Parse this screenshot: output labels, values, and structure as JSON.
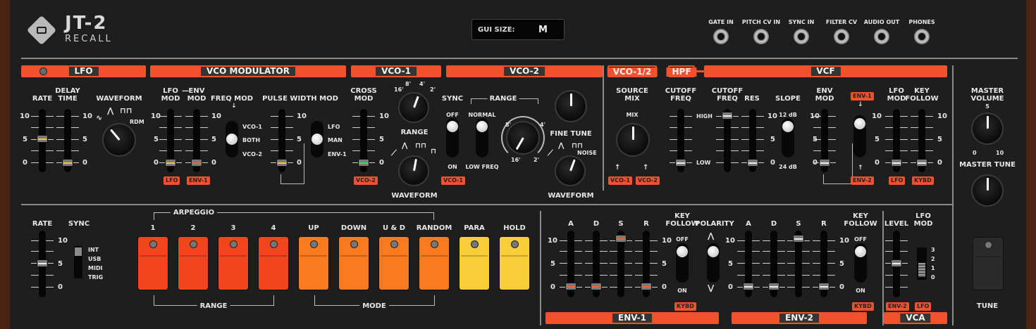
{
  "brand": {
    "title": "JT-2",
    "subtitle": "RECALL"
  },
  "gui_size": {
    "label": "GUI SIZE:",
    "value": "M"
  },
  "jacks": [
    "GATE IN",
    "PITCH CV IN",
    "SYNC IN",
    "FILTER CV",
    "AUDIO OUT",
    "PHONES"
  ],
  "sections": {
    "lfo": "LFO",
    "vco_mod": "VCO MODULATOR",
    "vco1": "VCO-1",
    "vco2": "VCO-2",
    "vco12": "VCO-1/2",
    "hpf": "HPF",
    "vcf": "VCF",
    "env1": "ENV-1",
    "env2": "ENV-2",
    "vca": "VCA"
  },
  "lfo": {
    "rate": "RATE",
    "delay1": "DELAY",
    "delay2": "TIME",
    "waveform": "WAVEFORM",
    "rdm": "RDM"
  },
  "vco_mod": {
    "lfo1": "LFO",
    "lfo2": "MOD",
    "dash": "—",
    "env1": "ENV",
    "env2": "MOD",
    "freq_mod": "FREQ MOD",
    "pwm": "PULSE WIDTH MOD",
    "sw1": [
      "VCO-1",
      "BOTH",
      "VCO-2"
    ],
    "sw2": [
      "LFO",
      "MAN",
      "ENV-1"
    ]
  },
  "vco1": {
    "cross1": "CROSS",
    "cross2": "MOD",
    "range": "RANGE",
    "waveform": "WAVEFORM",
    "r16": "16'",
    "r8": "8'",
    "r4": "4'",
    "r2": "2'"
  },
  "vco2": {
    "sync": "SYNC",
    "off": "OFF",
    "on": "ON",
    "range": "RANGE",
    "normal": "NORMAL",
    "low_freq": "LOW FREQ",
    "fine_tune": "FINE TUNE",
    "waveform": "WAVEFORM",
    "noise": "NOISE"
  },
  "mix": {
    "source1": "SOURCE",
    "source2": "MIX",
    "mix": "MIX"
  },
  "hpf": {
    "cutoff1": "CUTOFF",
    "cutoff2": "FREQ",
    "high": "HIGH",
    "low": "LOW"
  },
  "vcf": {
    "cutoff1": "CUTOFF",
    "cutoff2": "FREQ",
    "res": "RES",
    "slope": "SLOPE",
    "db12": "12 dB",
    "db24": "24 dB",
    "env1": "ENV",
    "env2": "MOD",
    "lfo1": "LFO",
    "lfo2": "MOD",
    "kf1": "KEY",
    "kf2": "FOLLOW"
  },
  "master": {
    "vol1": "MASTER",
    "vol2": "VOLUME",
    "five": "5",
    "zero": "0",
    "ten": "10",
    "tune": "MASTER TUNE",
    "tune_btn": "TUNE"
  },
  "scale": {
    "ten": "10",
    "five": "5",
    "zero": "0"
  },
  "badges": {
    "lfo": "LFO",
    "env1": "ENV-1",
    "env2": "ENV-2",
    "vco1": "VCO-1",
    "vco2": "VCO-2",
    "kybd": "KYBD"
  },
  "arp": {
    "rate": "RATE",
    "sync": "SYNC",
    "title": "ARPEGGIO",
    "sync_opts": [
      "INT",
      "USB",
      "MIDI",
      "TRIG"
    ],
    "range": "RANGE",
    "mode": "MODE",
    "buttons": [
      "1",
      "2",
      "3",
      "4",
      "UP",
      "DOWN",
      "U & D",
      "RANDOM",
      "PARA",
      "HOLD"
    ]
  },
  "env": {
    "a": "A",
    "d": "D",
    "s": "S",
    "r": "R",
    "kf1": "KEY",
    "kf2": "FOLLOW",
    "polarity": "POLARITY",
    "off": "OFF",
    "on": "ON"
  },
  "vca": {
    "level": "LEVEL",
    "lfo1": "LFO",
    "lfo2": "MOD",
    "sw": [
      "3",
      "2",
      "1",
      "0"
    ]
  },
  "colors": {
    "accent": "#f0522e",
    "panel": "#1e1e1e",
    "wood": "#4a2412",
    "btn_red": "#f2441e",
    "btn_orange": "#fb7a1e",
    "btn_yellow": "#f8cd3a"
  }
}
